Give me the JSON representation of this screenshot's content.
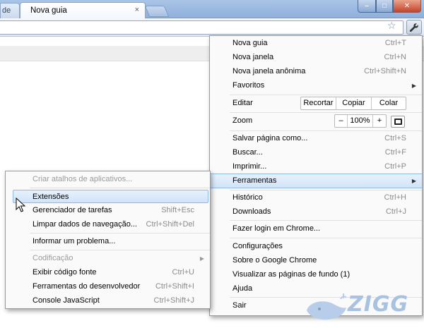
{
  "tabs": [
    {
      "label": "de"
    },
    {
      "label": "Nova guia",
      "close": "×"
    }
  ],
  "icons": {
    "star": "☆",
    "wrench": "🔧",
    "submenu_arrow": "▶",
    "window_min": "–",
    "window_max": "□",
    "window_close": "✕"
  },
  "main_menu": {
    "new_tab": {
      "label": "Nova guia",
      "shortcut": "Ctrl+T"
    },
    "new_window": {
      "label": "Nova janela",
      "shortcut": "Ctrl+N"
    },
    "new_incognito": {
      "label": "Nova janela anônima",
      "shortcut": "Ctrl+Shift+N"
    },
    "bookmarks": {
      "label": "Favoritos"
    },
    "edit": {
      "label": "Editar",
      "cut": "Recortar",
      "copy": "Copiar",
      "paste": "Colar"
    },
    "zoom": {
      "label": "Zoom",
      "minus": "–",
      "value": "100%",
      "plus": "+"
    },
    "save_page": {
      "label": "Salvar página como...",
      "shortcut": "Ctrl+S"
    },
    "find": {
      "label": "Buscar...",
      "shortcut": "Ctrl+F"
    },
    "print": {
      "label": "Imprimir...",
      "shortcut": "Ctrl+P"
    },
    "tools": {
      "label": "Ferramentas"
    },
    "history": {
      "label": "Histórico",
      "shortcut": "Ctrl+H"
    },
    "downloads": {
      "label": "Downloads",
      "shortcut": "Ctrl+J"
    },
    "sign_in": {
      "label": "Fazer login em Chrome..."
    },
    "settings": {
      "label": "Configurações"
    },
    "about": {
      "label": "Sobre o Google Chrome"
    },
    "background_pages": {
      "label": "Visualizar as páginas de fundo (1)"
    },
    "help": {
      "label": "Ajuda"
    },
    "exit": {
      "label": "Sair"
    }
  },
  "tools_menu": {
    "create_shortcuts": {
      "label": "Criar atalhos de aplicativos..."
    },
    "extensions": {
      "label": "Extensões"
    },
    "task_manager": {
      "label": "Gerenciador de tarefas",
      "shortcut": "Shift+Esc"
    },
    "clear_data": {
      "label": "Limpar dados de navegação...",
      "shortcut": "Ctrl+Shift+Del"
    },
    "report_issue": {
      "label": "Informar um problema..."
    },
    "encoding": {
      "label": "Codificação"
    },
    "view_source": {
      "label": "Exibir código fonte",
      "shortcut": "Ctrl+U"
    },
    "dev_tools": {
      "label": "Ferramentas do desenvolvedor",
      "shortcut": "Ctrl+Shift+I"
    },
    "js_console": {
      "label": "Console JavaScript",
      "shortcut": "Ctrl+Shift+J"
    }
  },
  "watermark": {
    "text": "ZIGG"
  }
}
